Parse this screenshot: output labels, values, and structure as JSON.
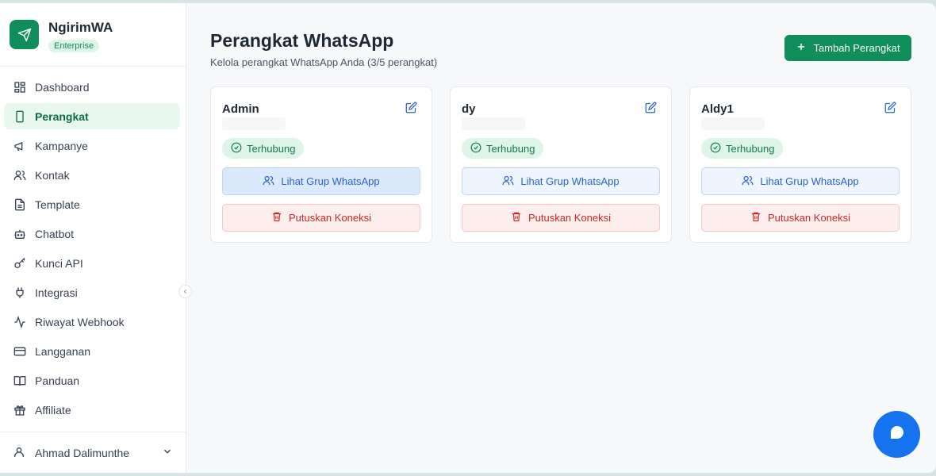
{
  "brand": {
    "name": "NgirimWA",
    "badge": "Enterprise"
  },
  "sidebar": {
    "items": [
      {
        "label": "Dashboard",
        "icon": "grid-icon",
        "active": false
      },
      {
        "label": "Perangkat",
        "icon": "smartphone-icon",
        "active": true
      },
      {
        "label": "Kampanye",
        "icon": "megaphone-icon",
        "active": false
      },
      {
        "label": "Kontak",
        "icon": "users-icon",
        "active": false
      },
      {
        "label": "Template",
        "icon": "document-icon",
        "active": false
      },
      {
        "label": "Chatbot",
        "icon": "bot-icon",
        "active": false
      },
      {
        "label": "Kunci API",
        "icon": "key-icon",
        "active": false
      },
      {
        "label": "Integrasi",
        "icon": "plug-icon",
        "active": false
      },
      {
        "label": "Riwayat Webhook",
        "icon": "activity-icon",
        "active": false
      },
      {
        "label": "Langganan",
        "icon": "credit-card-icon",
        "active": false
      },
      {
        "label": "Panduan",
        "icon": "book-icon",
        "active": false
      },
      {
        "label": "Affiliate",
        "icon": "gift-icon",
        "active": false
      }
    ],
    "user": {
      "name": "Ahmad Dalimunthe"
    }
  },
  "main": {
    "title": "Perangkat WhatsApp",
    "subtitle": "Kelola perangkat WhatsApp Anda (3/5 perangkat)",
    "add_button": "Tambah Perangkat",
    "devices": [
      {
        "name": "Admin",
        "status": "Terhubung",
        "groups_button": "Lihat Grup WhatsApp",
        "disconnect_button": "Putuskan Koneksi"
      },
      {
        "name": "dy",
        "status": "Terhubung",
        "groups_button": "Lihat Grup WhatsApp",
        "disconnect_button": "Putuskan Koneksi"
      },
      {
        "name": "Aldy1",
        "status": "Terhubung",
        "groups_button": "Lihat Grup WhatsApp",
        "disconnect_button": "Putuskan Koneksi"
      }
    ]
  },
  "colors": {
    "brand": "#0f8d5a",
    "fab": "#1573f0",
    "danger": "#c62828",
    "info": "#2c63c9"
  }
}
